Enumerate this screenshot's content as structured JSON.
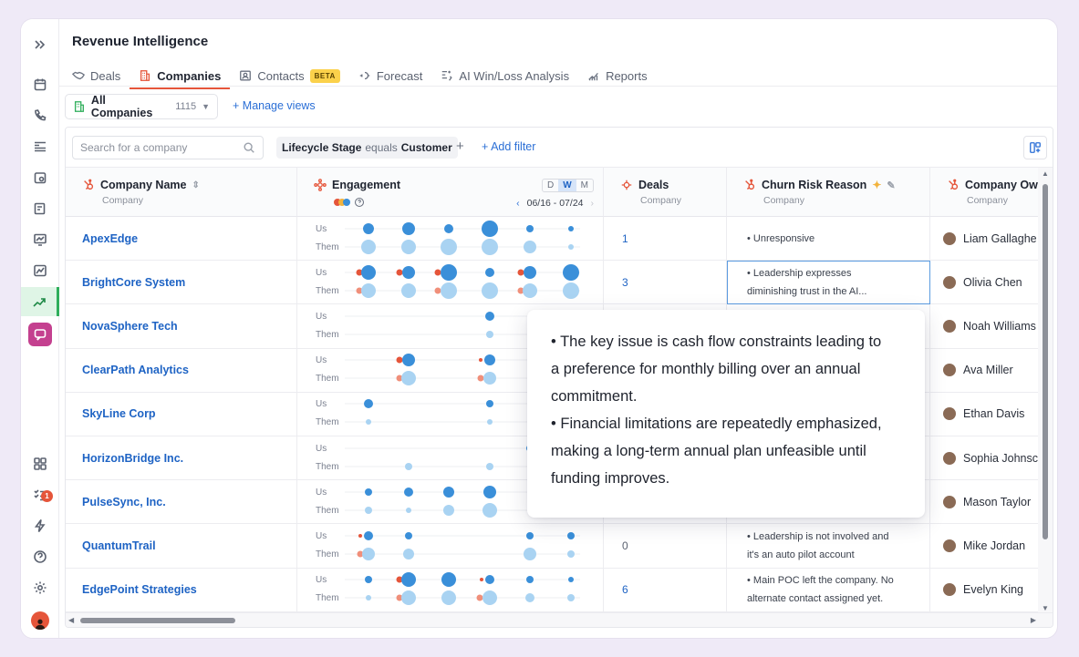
{
  "app": {
    "title": "Revenue Intelligence"
  },
  "tabs": [
    {
      "label": "Deals",
      "icon": "handshake-icon"
    },
    {
      "label": "Companies",
      "icon": "building-icon",
      "active": true
    },
    {
      "label": "Contacts",
      "icon": "contact-card-icon",
      "badge": "BETA"
    },
    {
      "label": "Forecast",
      "icon": "forecast-icon"
    },
    {
      "label": "AI Win/Loss Analysis",
      "icon": "ai-analysis-icon"
    },
    {
      "label": "Reports",
      "icon": "reports-icon"
    }
  ],
  "view": {
    "name": "All Companies",
    "count": "1115",
    "manage_label": "Manage views"
  },
  "filters": {
    "search_placeholder": "Search for a company",
    "chip_field": "Lifecycle Stage",
    "chip_op": "equals",
    "chip_value": "Customer",
    "add_label": "Add filter"
  },
  "columns": {
    "company": {
      "title": "Company Name",
      "sub": "Company"
    },
    "engagement": {
      "title": "Engagement",
      "range": "06/16 - 07/24",
      "periods": [
        "D",
        "W",
        "M"
      ],
      "active_period": "W"
    },
    "deals": {
      "title": "Deals",
      "sub": "Company"
    },
    "churn": {
      "title": "Churn Risk Reason",
      "sub": "Company"
    },
    "owner": {
      "title": "Company Owr",
      "sub": "Company"
    }
  },
  "row_labels": {
    "us": "Us",
    "them": "Them"
  },
  "rows": [
    {
      "name": "ApexEdge",
      "deals": "1",
      "reason": "• Unresponsive",
      "reason2": "",
      "owner": "Liam Gallaghe"
    },
    {
      "name": "BrightCore System",
      "deals": "3",
      "reason": "• Leadership expresses",
      "reason2": "diminishing trust in the AI...",
      "owner": "Olivia Chen"
    },
    {
      "name": "NovaSphere Tech",
      "deals": "",
      "reason": "",
      "reason2": "",
      "owner": "Noah Williams"
    },
    {
      "name": "ClearPath Analytics",
      "deals": "",
      "reason": "",
      "reason2": "",
      "owner": "Ava Miller"
    },
    {
      "name": "SkyLine Corp",
      "deals": "",
      "reason": "",
      "reason2": "",
      "owner": "Ethan Davis"
    },
    {
      "name": "HorizonBridge Inc.",
      "deals": "",
      "reason": "",
      "reason2": "",
      "owner": "Sophia Johnsc"
    },
    {
      "name": "PulseSync, Inc.",
      "deals": "",
      "reason": "",
      "reason2": "",
      "owner": "Mason Taylor"
    },
    {
      "name": "QuantumTrail",
      "deals": "0",
      "reason": "• Leadership is not involved and",
      "reason2": "it's an auto pilot account",
      "owner": "Mike Jordan"
    },
    {
      "name": "EdgePoint Strategies",
      "deals": "6",
      "reason": "• Main POC left the company. No",
      "reason2": "alternate contact assigned yet.",
      "owner": "Evelyn King"
    }
  ],
  "tooltip": {
    "lines": [
      "• The key issue is cash flow constraints leading to",
      "a preference for monthly billing over an annual",
      "commitment.",
      "• Financial limitations are repeatedly emphasized,",
      "making a long-term annual plan unfeasible until",
      "funding improves."
    ]
  },
  "notifications": {
    "count": "1"
  },
  "colors": {
    "accent": "#e5553a",
    "link": "#1e63c4",
    "us_dot": "#3a8fd9",
    "them_dot": "#a9d3f2",
    "alert_dot": "#e5553a",
    "active_nav": "#2fae5b"
  }
}
